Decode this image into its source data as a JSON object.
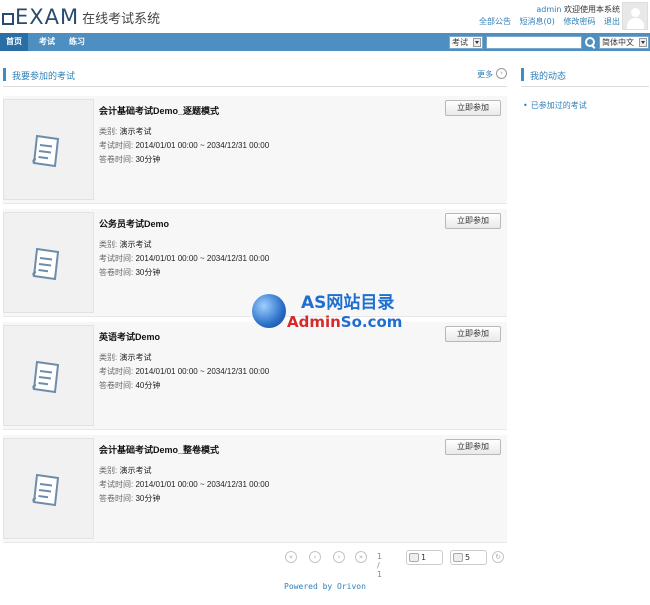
{
  "header": {
    "logo_text": "EXAM",
    "logo_subtitle": "在线考试系统",
    "username": "admin",
    "welcome": "欢迎使用本系统",
    "links": [
      "全部公告",
      "短消息(0)",
      "修改密码",
      "退出"
    ]
  },
  "nav": {
    "items": [
      "首页",
      "考试",
      "练习"
    ],
    "search_scope": "考试",
    "search_value": "",
    "language": "简体中文"
  },
  "main": {
    "section_title": "我要参加的考试",
    "more_label": "更多",
    "category_label": "类别:",
    "time_label": "考试时间:",
    "duration_label": "答卷时间:",
    "join_label": "立即参加",
    "exams": [
      {
        "name": "会计基础考试Demo_逐题模式",
        "category": "演示考试",
        "time": "2014/01/01 00:00 ~ 2034/12/31 00:00",
        "duration": "30分钟"
      },
      {
        "name": "公务员考试Demo",
        "category": "演示考试",
        "time": "2014/01/01 00:00 ~ 2034/12/31 00:00",
        "duration": "30分钟"
      },
      {
        "name": "英语考试Demo",
        "category": "演示考试",
        "time": "2014/01/01 00:00 ~ 2034/12/31 00:00",
        "duration": "40分钟"
      },
      {
        "name": "会计基础考试Demo_整卷模式",
        "category": "演示考试",
        "time": "2014/01/01 00:00 ~ 2034/12/31 00:00",
        "duration": "30分钟"
      }
    ]
  },
  "pager": {
    "page_text": "1 / 1",
    "page_value": "1",
    "page_size": "5"
  },
  "sidebar": {
    "title": "我的动态",
    "items": [
      "已参加过的考试"
    ]
  },
  "footer": {
    "text": "Powered by Orivon"
  },
  "watermark": {
    "line1": "AS网站目录",
    "line2_a": "Admin",
    "line2_b": "So.com"
  }
}
